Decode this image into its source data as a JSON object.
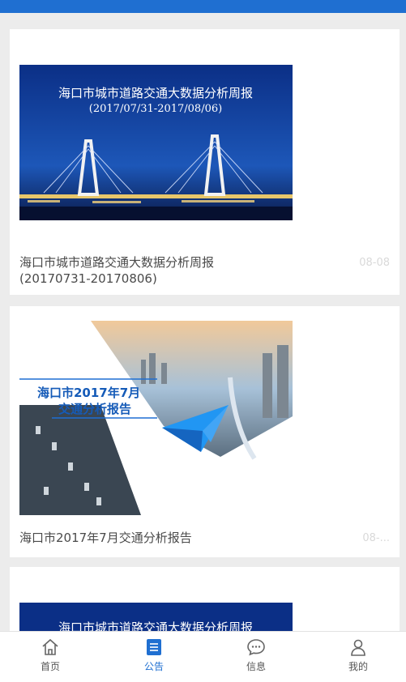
{
  "cards": [
    {
      "image_title": "海口市城市道路交通大数据分析周报",
      "image_subtitle": "(2017/07/31-2017/08/06)",
      "title": "海口市城市道路交通大数据分析周报(20170731-20170806)",
      "date": "08-08"
    },
    {
      "image_title_line1": "海口市2017年7月",
      "image_title_line2": "交通分析报告",
      "title": "海口市2017年7月交通分析报告",
      "date": "08-..."
    },
    {
      "image_title": "海口市城市道路交通大数据分析周报"
    }
  ],
  "nav": [
    {
      "label": "首页",
      "icon": "home-icon"
    },
    {
      "label": "公告",
      "icon": "announcement-icon",
      "active": true
    },
    {
      "label": "信息",
      "icon": "message-icon"
    },
    {
      "label": "我的",
      "icon": "profile-icon"
    }
  ],
  "colors": {
    "accent": "#1f6fd1",
    "background": "#ececec"
  }
}
